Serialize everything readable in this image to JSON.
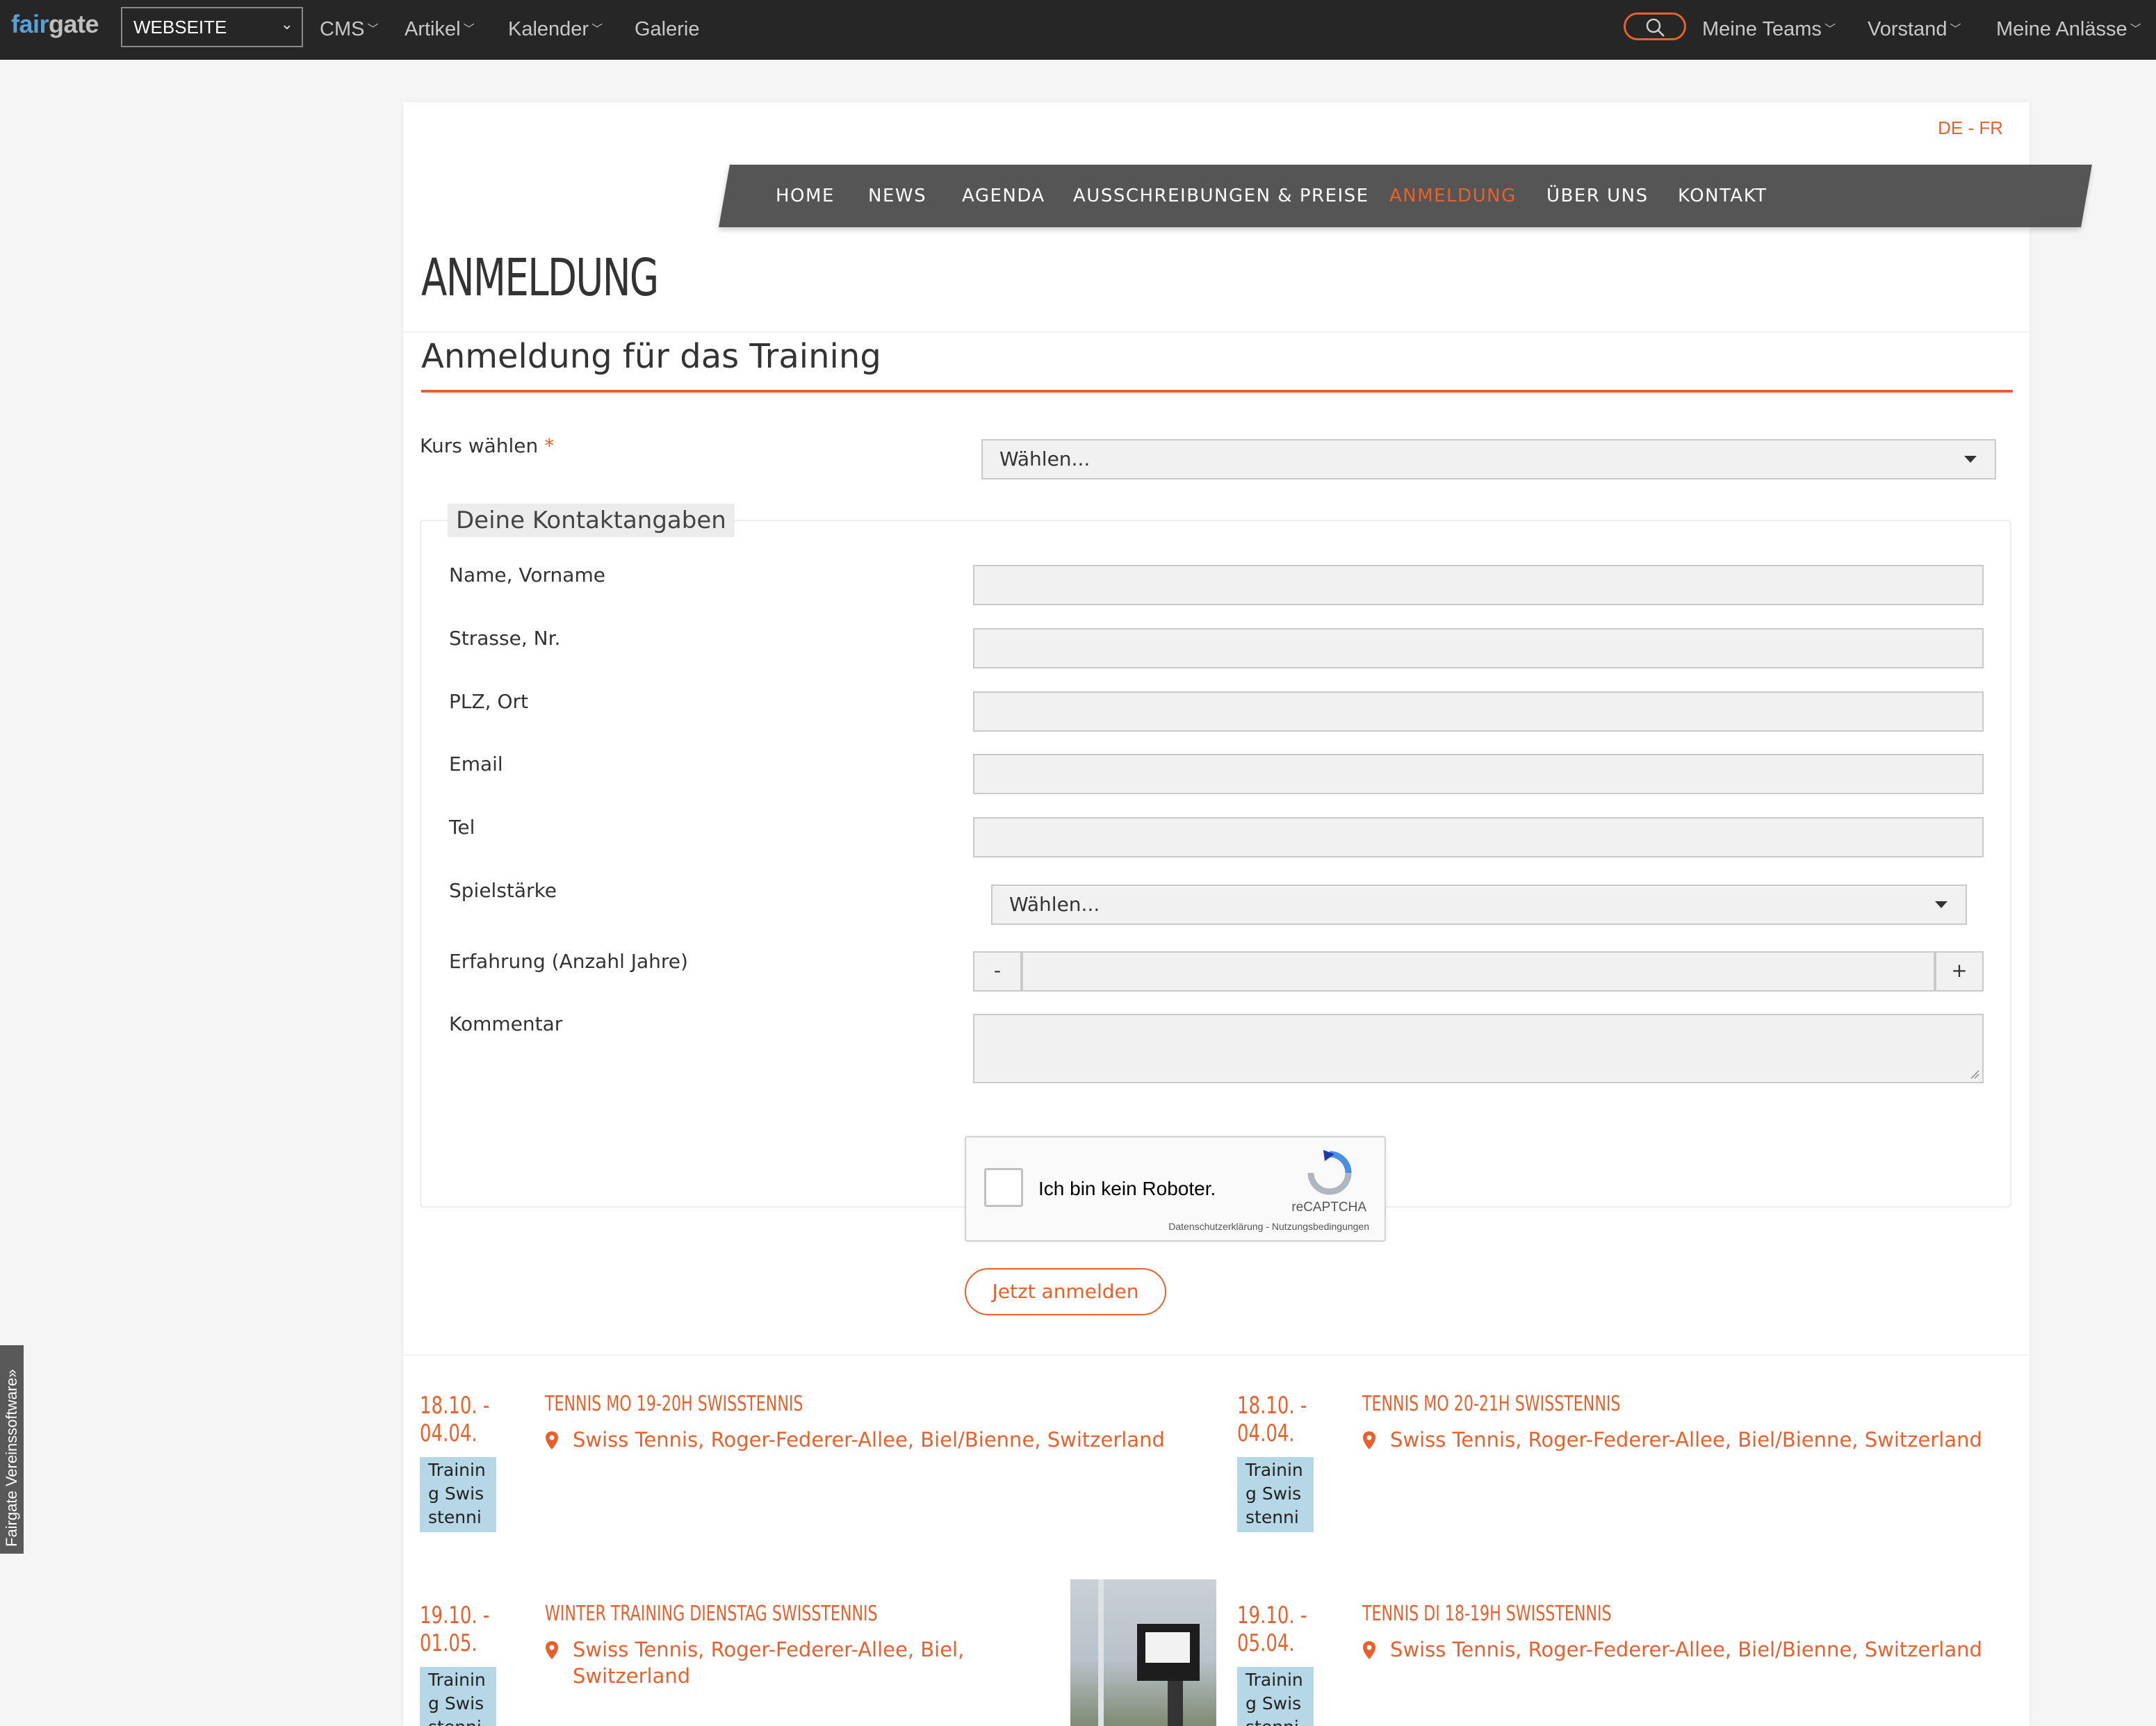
{
  "topbar": {
    "logo_fair": "fair",
    "logo_gate": "gate",
    "site_select": "WEBSEITE",
    "menu": [
      {
        "label": "CMS"
      },
      {
        "label": "Artikel"
      },
      {
        "label": "Kalender"
      },
      {
        "label": "Galerie"
      }
    ],
    "right_menu": [
      {
        "label": "Meine Teams"
      },
      {
        "label": "Vorstand"
      },
      {
        "label": "Meine Anlässe"
      }
    ]
  },
  "lang": "DE - FR",
  "nav": [
    {
      "label": "HOME"
    },
    {
      "label": "NEWS"
    },
    {
      "label": "AGENDA"
    },
    {
      "label": "AUSSCHREIBUNGEN & PREISE"
    },
    {
      "label": "ANMELDUNG",
      "active": true
    },
    {
      "label": "ÜBER UNS"
    },
    {
      "label": "KONTAKT"
    }
  ],
  "page_title": "ANMELDUNG",
  "form": {
    "title": "Anmeldung für das Training",
    "course_label": "Kurs wählen",
    "required_mark": "*",
    "course_value": "Wählen...",
    "fieldset_legend": "Deine Kontaktangaben",
    "fields": {
      "name": "Name, Vorname",
      "street": "Strasse, Nr.",
      "zip": "PLZ, Ort",
      "email": "Email",
      "tel": "Tel",
      "level": "Spielstärke",
      "level_value": "Wählen...",
      "experience": "Erfahrung (Anzahl Jahre)",
      "comment": "Kommentar"
    },
    "stepper_minus": "-",
    "stepper_plus": "+",
    "captcha_text": "Ich bin kein Roboter.",
    "captcha_brand": "reCAPTCHA",
    "captcha_links": "Datenschutzerklärung - Nutzungsbedingungen",
    "submit": "Jetzt anmelden"
  },
  "events": [
    {
      "date1": "18.10. -",
      "date2": "04.04.",
      "badge": "Training Swisstennis",
      "title": "TENNIS MO 19-20H SWISSTENNIS",
      "location": "Swiss Tennis, Roger-Federer-Allee, Biel/Bienne, Switzerland"
    },
    {
      "date1": "18.10. -",
      "date2": "04.04.",
      "badge": "Training Swisstennis",
      "title": "TENNIS MO 20-21H SWISSTENNIS",
      "location": "Swiss Tennis, Roger-Federer-Allee, Biel/Bienne, Switzerland"
    },
    {
      "date1": "19.10. -",
      "date2": "01.05.",
      "badge": "Training Swisstennis",
      "title": "WINTER TRAINING DIENSTAG SWISSTENNIS",
      "location_1": "Swiss Tennis, Roger-Federer-Allee, Biel,",
      "location_2": "Switzerland"
    },
    {
      "date1": "19.10. -",
      "date2": "05.04.",
      "badge": "Training Swisstennis",
      "title": "TENNIS DI 18-19H SWISSTENNIS",
      "location": "Swiss Tennis, Roger-Federer-Allee, Biel/Bienne, Switzerland"
    }
  ],
  "side_tab": "Fairgate Vereinssoftware»",
  "colors": {
    "accent": "#e8612c",
    "topbar": "#262626",
    "nav": "#555555",
    "badge": "#b6d7e6"
  }
}
